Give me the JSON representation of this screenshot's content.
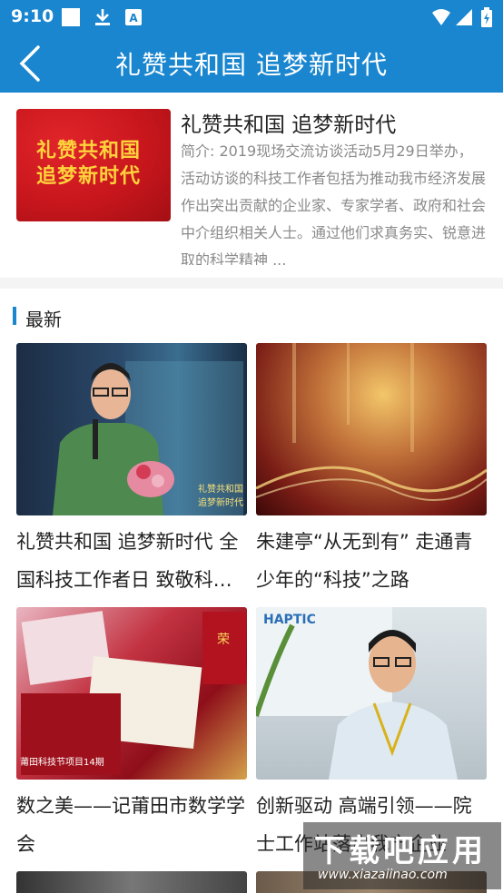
{
  "status_bar": {
    "time": "9:10"
  },
  "app_bar": {
    "title": "礼赞共和国 追梦新时代"
  },
  "intro": {
    "cover_line1": "礼赞共和国",
    "cover_line2": "追梦新时代",
    "title": "礼赞共和国 追梦新时代",
    "description": "简介: 2019现场交流访谈活动5月29日举办，活动访谈的科技工作者包括为推动我市经济发展作出突出贡献的企业家、专家学者、政府和社会中介组织相关人士。通过他们求真务实、锐意进取的科学精神 ..."
  },
  "section": {
    "label": "最新"
  },
  "cards": [
    {
      "title": "礼赞共和国 追梦新时代  全国科技工作者日 致敬科…",
      "overlay": "礼赞共和国 追梦新时代"
    },
    {
      "title": "朱建亭“从无到有” 走通青少年的“科技”之路"
    },
    {
      "title": "数之美——记莆田市数学学会",
      "overlay": "莆田科技节项目14期"
    },
    {
      "title": "创新驱动 高端引领——院士工作站落户我市企业",
      "overlay": "HAPTIC"
    }
  ],
  "watermark": {
    "big": "下载吧应用",
    "small": "www.xiazaiinao.com"
  },
  "colors": {
    "primary": "#1a86cf",
    "cover_red": "#c8161d",
    "cover_gold": "#ffd33c"
  }
}
